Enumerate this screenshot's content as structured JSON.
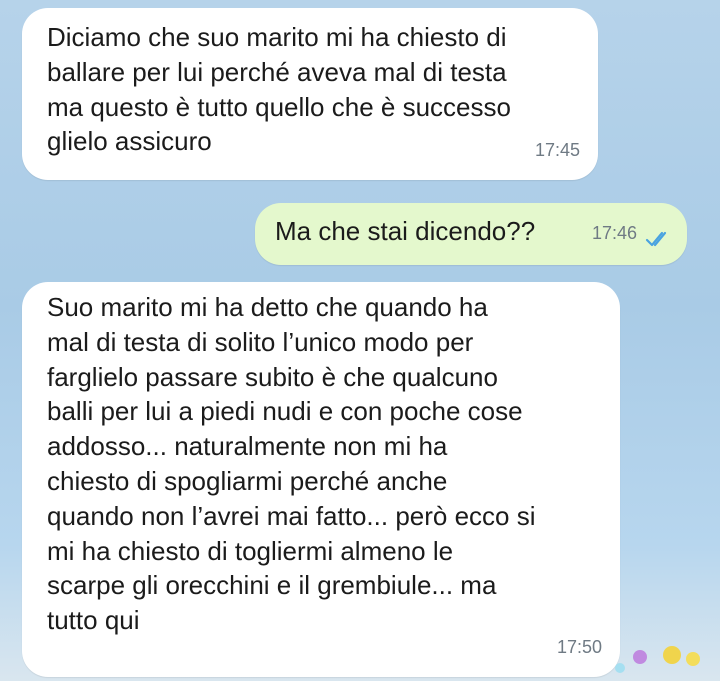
{
  "messages": [
    {
      "text": "Diciamo che suo marito mi ha chiesto di\nballare per lui perché aveva mal di testa\nma questo è tutto quello che è successo\nglielo assicuro",
      "time": "17:45"
    },
    {
      "text": "Ma che stai dicendo??",
      "time": "17:46",
      "status_icon": "double-check-icon"
    },
    {
      "text": "Suo marito mi ha detto che quando ha\nmal di testa di solito l’unico modo per\nfarglielo passare subito è che qualcuno\nballi per lui a piedi nudi e con poche cose\naddosso... naturalmente non mi ha\nchiesto di spogliarmi perché anche\nquando non l’avrei mai fatto... però ecco si\nmi ha chiesto di togliermi almeno le\nscarpe gli orecchini e il grembiule... ma\ntutto qui",
      "time": "17:50"
    }
  ],
  "colors": {
    "incoming_bubble": "#ffffff",
    "outgoing_bubble": "#e4f8cd",
    "read_check": "#4aa3e0",
    "meta_text": "#6f7a84"
  }
}
